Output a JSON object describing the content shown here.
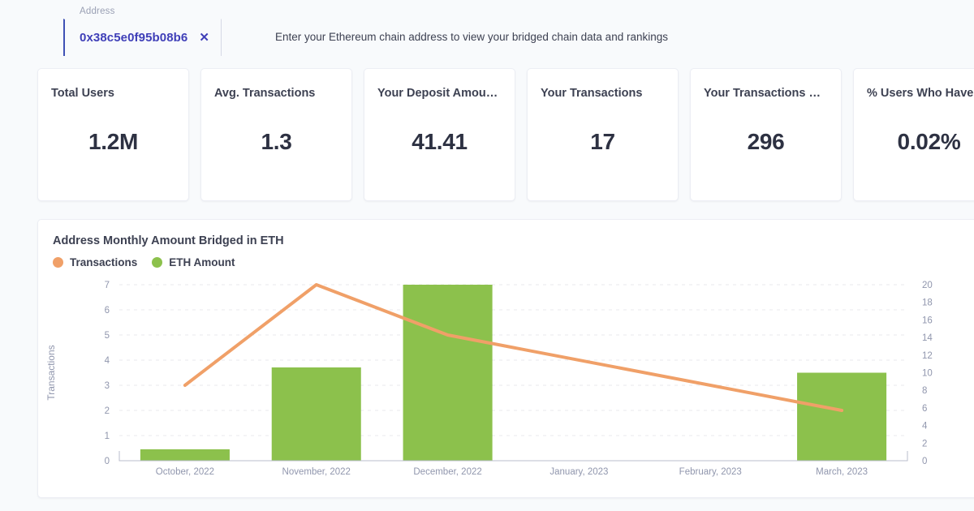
{
  "address_field": {
    "label": "Address",
    "value": "0x38c5e0f95b08b6",
    "clear_icon": "close-icon",
    "clear_glyph": "✕",
    "hint": "Enter your Ethereum chain address to view your bridged chain data and rankings"
  },
  "stat_cards": [
    {
      "title": "Total Users",
      "value": "1.2M"
    },
    {
      "title": "Avg. Transactions",
      "value": "1.3"
    },
    {
      "title": "Your Deposit Amoun…",
      "value": "41.41"
    },
    {
      "title": "Your Transactions",
      "value": "17"
    },
    {
      "title": "Your Transactions R…",
      "value": "296"
    },
    {
      "title": "% Users Who Have …",
      "value": "0.02%"
    }
  ],
  "chart_panel": {
    "title": "Address Monthly Amount Bridged in ETH",
    "legend": [
      {
        "label": "Transactions",
        "color": "#f0a068"
      },
      {
        "label": "ETH Amount",
        "color": "#8cc14c"
      }
    ]
  },
  "chart_data": {
    "type": "bar",
    "title": "Address Monthly Amount Bridged in ETH",
    "xlabel": "",
    "ylabel": "Transactions",
    "y2label": "",
    "categories": [
      "October, 2022",
      "November, 2022",
      "December, 2022",
      "January, 2023",
      "February, 2023",
      "March, 2023"
    ],
    "ylim": [
      0,
      7
    ],
    "y2lim": [
      0,
      20
    ],
    "yticks": [
      0,
      1,
      2,
      3,
      4,
      5,
      6,
      7
    ],
    "y2ticks": [
      0,
      2,
      4,
      6,
      8,
      10,
      12,
      14,
      16,
      18,
      20
    ],
    "grid": true,
    "legend_position": "top-left",
    "series": [
      {
        "name": "ETH Amount",
        "type": "bar",
        "axis": "right",
        "color": "#8cc14c",
        "values": [
          1.3,
          10.6,
          20.0,
          0,
          0,
          10.0
        ]
      },
      {
        "name": "Transactions",
        "type": "line",
        "axis": "left",
        "color": "#f0a068",
        "values": [
          3,
          7,
          5,
          null,
          null,
          2
        ]
      }
    ]
  }
}
